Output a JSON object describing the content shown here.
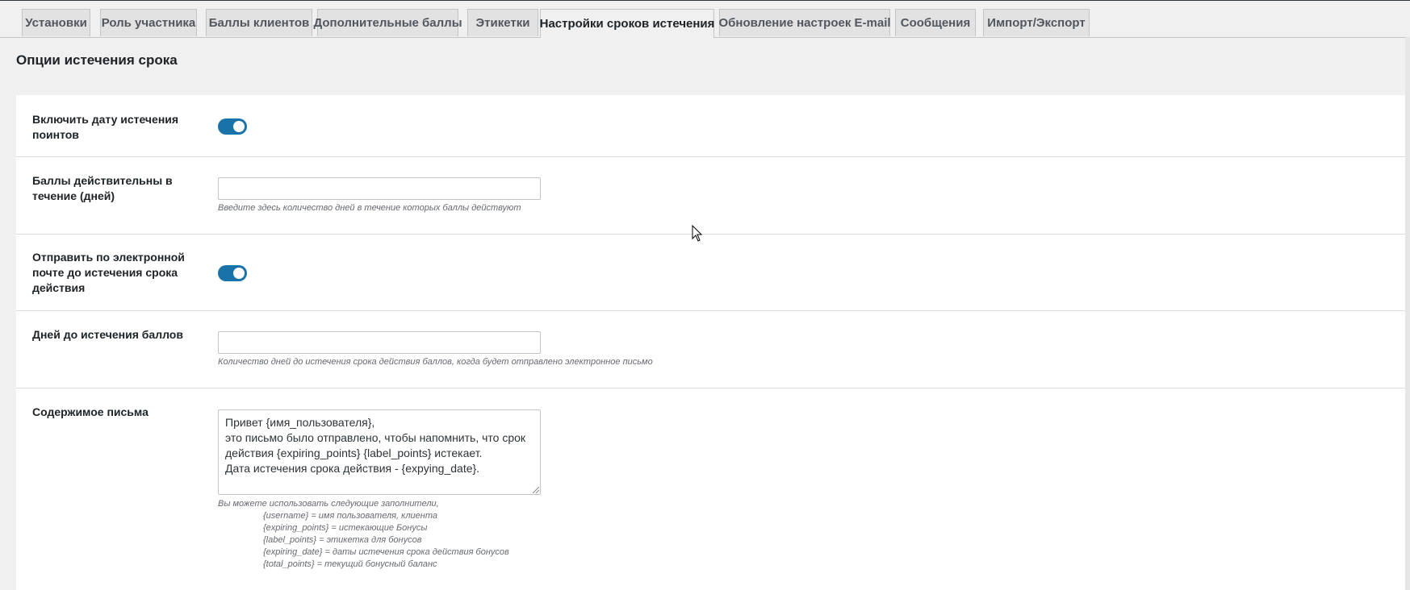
{
  "tabs": [
    {
      "label": "Установки"
    },
    {
      "label": "Роль участника"
    },
    {
      "label": "Баллы клиентов"
    },
    {
      "label": "Дополнительные баллы"
    },
    {
      "label": "Этикетки"
    },
    {
      "label": "Настройки сроков истечения",
      "active": true
    },
    {
      "label": "Обновление настроек E-mail"
    },
    {
      "label": "Сообщения"
    },
    {
      "label": "Импорт/Экспорт"
    }
  ],
  "section_title": "Опции истечения срока",
  "fields": {
    "enable_expiry": {
      "label": "Включить дату истечения поинтов",
      "enabled": true
    },
    "valid_days": {
      "label": "Баллы действительны в течение (дней)",
      "value": "",
      "hint": "Введите здесь количество дней в течение которых баллы действуют"
    },
    "send_email": {
      "label": "Отправить по электронной почте до истечения срока действия",
      "enabled": true
    },
    "days_before": {
      "label": "Дней до истечения баллов",
      "value": "",
      "hint": "Количество дней до истечения срока действия баллов, когда будет отправлено электронное письмо"
    },
    "email_content": {
      "label": "Содержимое письма",
      "lines": [
        "Привет {имя_пользователя},",
        "это письмо было отправлено, чтобы напомнить, что срок",
        "действия {expiring_points} {label_points} истекает.",
        "Дата истечения срока действия - {expying_date}."
      ],
      "placeholders_intro": "Вы можете использовать следующие заполнители,",
      "placeholders": [
        "{username} = имя пользователя, клиента",
        "{expiring_points} = истекающие Бонусы",
        "{label_points} = этикетка для бонусов",
        "{expiring_date} = даты истечения срока действия бонусов",
        "{total_points} = текущий бонусный баланс"
      ]
    }
  },
  "colors": {
    "toggle_on": "#1a73a8",
    "page_bg": "#f0f0f1",
    "panel_bg": "#ffffff"
  }
}
